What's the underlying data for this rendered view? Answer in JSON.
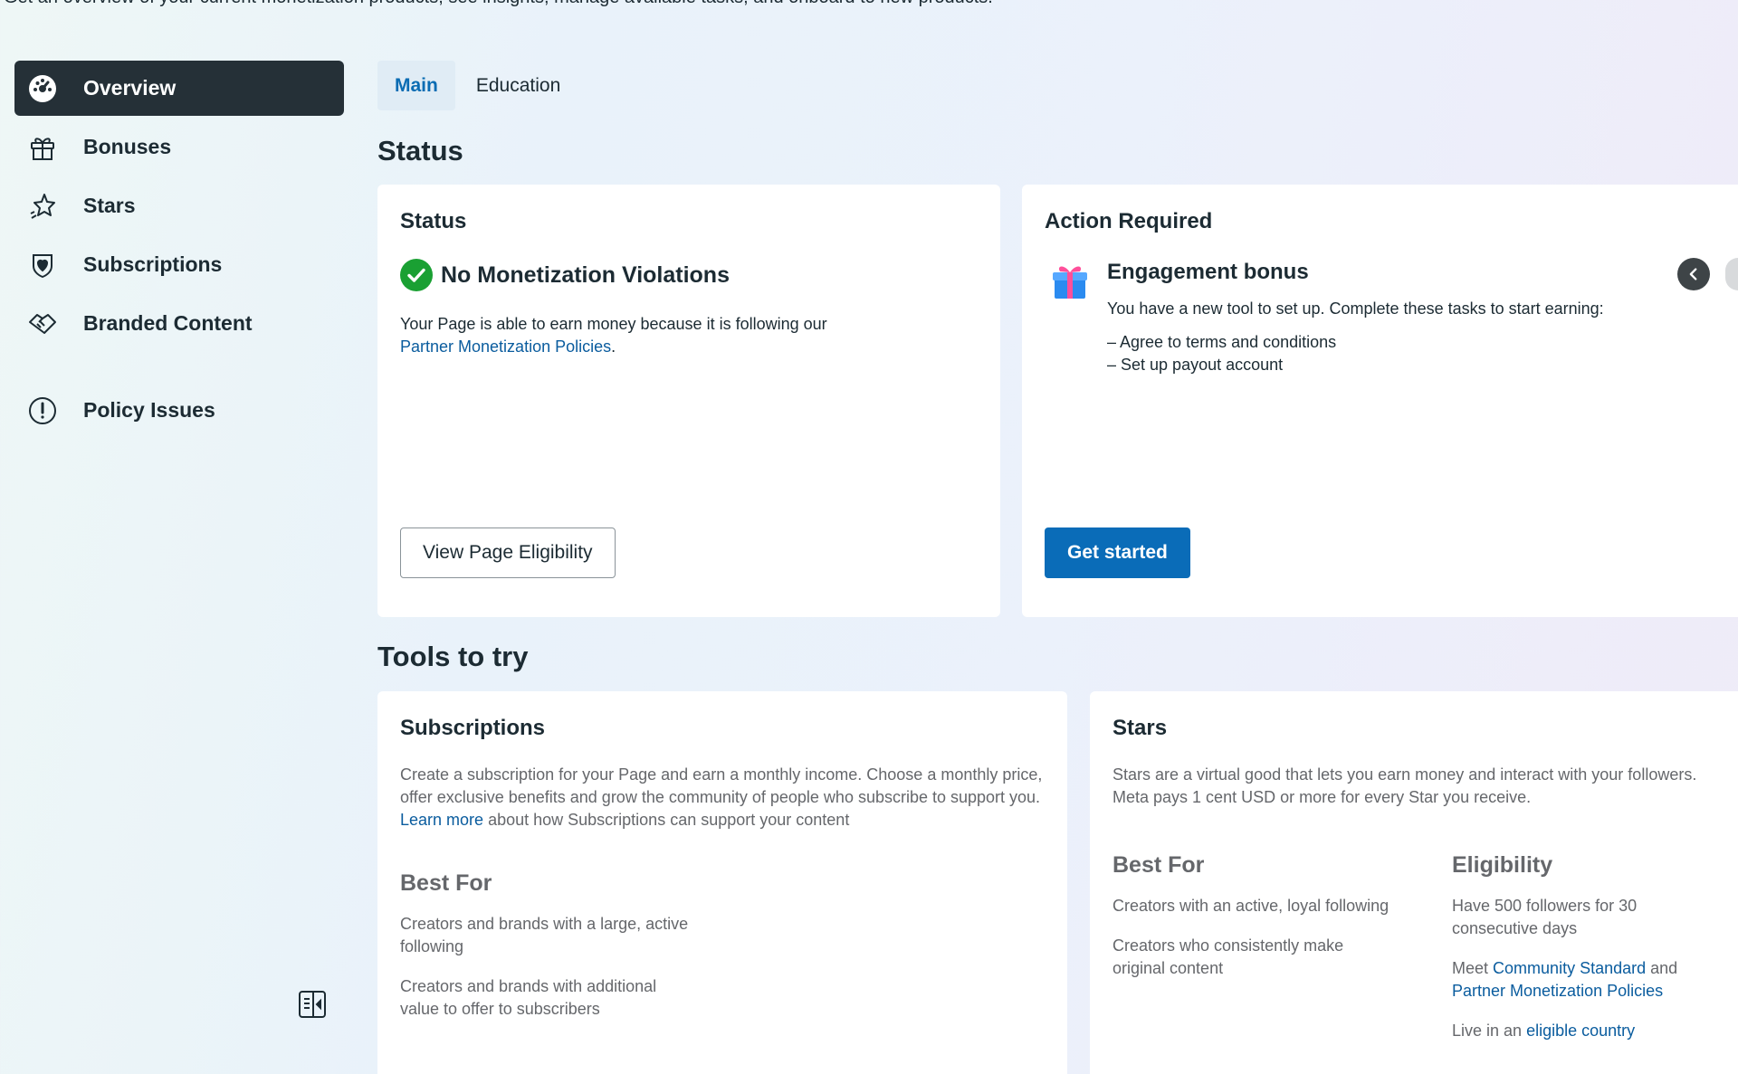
{
  "page": {
    "subtitle": "Get an overview of your current monetization products, see insights, manage available tasks, and onboard to new products."
  },
  "sidebar": {
    "items": [
      {
        "label": "Overview",
        "icon": "dashboard-icon",
        "active": true
      },
      {
        "label": "Bonuses",
        "icon": "gift-icon"
      },
      {
        "label": "Stars",
        "icon": "star-icon"
      },
      {
        "label": "Subscriptions",
        "icon": "heart-shield-icon"
      },
      {
        "label": "Branded Content",
        "icon": "handshake-icon"
      },
      {
        "label": "Policy Issues",
        "icon": "alert-circle-icon"
      }
    ],
    "collapse_icon": "sidebar-collapse-icon"
  },
  "tabs": [
    {
      "label": "Main",
      "active": true
    },
    {
      "label": "Education"
    }
  ],
  "status_section": {
    "heading": "Status",
    "status_card": {
      "title": "Status",
      "headline": "No Monetization Violations",
      "body": "Your Page is able to earn money because it is following our",
      "link": "Partner Monetization Policies",
      "link_suffix": ".",
      "button": "View Page Eligibility"
    },
    "action_card": {
      "title": "Action Required",
      "item_title": "Engagement bonus",
      "item_body": "You have a new tool to set up. Complete these tasks to start earning:",
      "tasks": [
        "– Agree to terms and conditions",
        "– Set up payout account"
      ],
      "button": "Get started"
    }
  },
  "tools_section": {
    "heading": "Tools to try",
    "subscriptions": {
      "title": "Subscriptions",
      "desc_before": "Create a subscription for your Page and earn a monthly income. Choose a monthly price, offer exclusive benefits and grow the community of people who subscribe to support you.",
      "desc_link": "Learn more",
      "desc_after": "about how Subscriptions can support your content",
      "best_for_heading": "Best For",
      "best_for": [
        "Creators and brands with a large, active following",
        "Creators and brands with additional value to offer to subscribers"
      ]
    },
    "stars": {
      "title": "Stars",
      "desc": "Stars are a virtual good that lets you earn money and interact with your followers. Meta pays 1 cent USD or more for every Star you receive.",
      "best_for_heading": "Best For",
      "best_for": [
        "Creators with an active, loyal following",
        "Creators who consistently make original content"
      ],
      "eligibility_heading": "Eligibility",
      "elig_1": "Have 500 followers for 30 consecutive days",
      "elig_2_prefix": "Meet",
      "elig_2_link1": "Community Standard",
      "elig_2_and": "and",
      "elig_2_link2": "Partner Monetization Policies",
      "elig_3_prefix": "Live in an",
      "elig_3_link": "eligible country"
    }
  },
  "colors": {
    "accent": "#0a6cb8",
    "active_nav": "#253037",
    "success": "#1aa033",
    "link": "#0a5c9e"
  }
}
